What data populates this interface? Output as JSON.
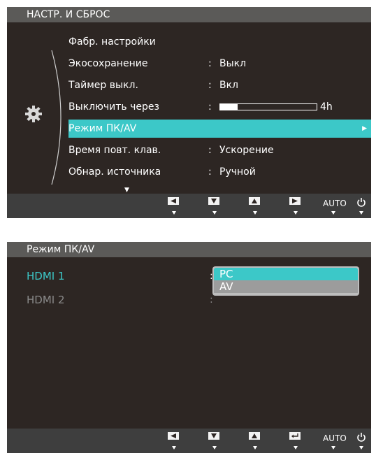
{
  "panel1": {
    "title": "НАСТР. И СБРОС",
    "items": [
      {
        "label": "Фабр. настройки",
        "colon": "",
        "value": ""
      },
      {
        "label": "Экосохранение",
        "colon": ":",
        "value": "Выкл"
      },
      {
        "label": "Таймер выкл.",
        "colon": ":",
        "value": "Вкл"
      },
      {
        "label": "Выключить через",
        "colon": ":",
        "value": ""
      },
      {
        "label": "Режим ПК/AV",
        "colon": "",
        "value": ""
      },
      {
        "label": "Время повт. клав.",
        "colon": ":",
        "value": "Ускорение"
      },
      {
        "label": "Обнар. источника",
        "colon": ":",
        "value": "Ручной"
      }
    ],
    "off_timer_label": "4h",
    "off_timer_fill_fraction": 0.18,
    "selected_index": 4,
    "auto_label": "AUTO"
  },
  "panel2": {
    "title": "Режим ПК/AV",
    "sources": [
      {
        "label": "HDMI 1",
        "colon": ":"
      },
      {
        "label": "HDMI 2",
        "colon": ":"
      }
    ],
    "dropdown_options": [
      "PC",
      "AV"
    ],
    "auto_label": "AUTO"
  },
  "colors": {
    "highlight": "#3cc8c8",
    "panel_bg": "#2d2623",
    "title_bg": "#5b5a58",
    "bottom_bar": "#3e3e3e"
  }
}
